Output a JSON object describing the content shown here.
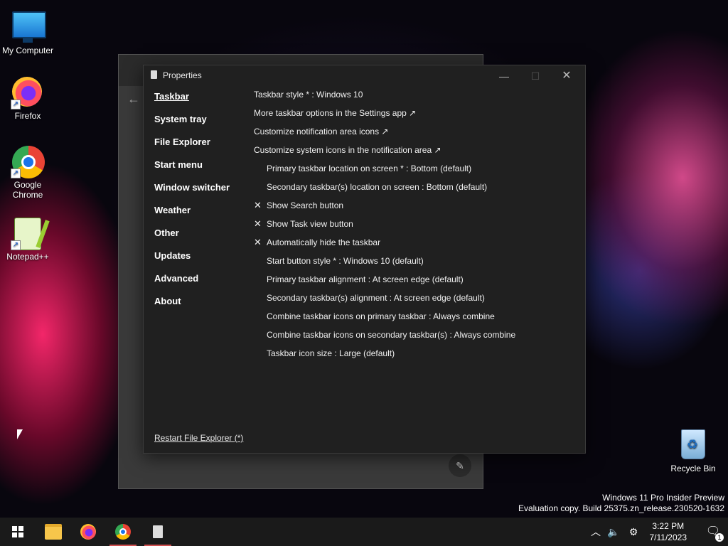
{
  "desktop": {
    "icons": [
      {
        "label": "My Computer"
      },
      {
        "label": "Firefox"
      },
      {
        "label": "Google Chrome"
      },
      {
        "label": "Notepad++"
      },
      {
        "label": "Recycle Bin"
      }
    ]
  },
  "window": {
    "title": "Properties",
    "nav": [
      {
        "label": "Taskbar"
      },
      {
        "label": "System tray"
      },
      {
        "label": "File Explorer"
      },
      {
        "label": "Start menu"
      },
      {
        "label": "Window switcher"
      },
      {
        "label": "Weather"
      },
      {
        "label": "Other"
      },
      {
        "label": "Updates"
      },
      {
        "label": "Advanced"
      },
      {
        "label": "About"
      }
    ],
    "settings": [
      {
        "label": "Taskbar style * : Windows 10"
      },
      {
        "label": "More taskbar options in the Settings app ↗"
      },
      {
        "label": "Customize notification area icons ↗"
      },
      {
        "label": "Customize system icons in the notification area ↗"
      },
      {
        "label": "Primary taskbar location on screen * : Bottom (default)"
      },
      {
        "label": "Secondary taskbar(s) location on screen : Bottom (default)"
      },
      {
        "label": "Show Search button",
        "mark": "✕"
      },
      {
        "label": "Show Task view button",
        "mark": "✕"
      },
      {
        "label": "Automatically hide the taskbar",
        "mark": "✕"
      },
      {
        "label": "Start button style * : Windows 10 (default)"
      },
      {
        "label": "Primary taskbar alignment : At screen edge (default)"
      },
      {
        "label": "Secondary taskbar(s) alignment : At screen edge (default)"
      },
      {
        "label": "Combine taskbar icons on primary taskbar : Always combine"
      },
      {
        "label": "Combine taskbar icons on secondary taskbar(s) : Always combine"
      },
      {
        "label": "Taskbar icon size : Large (default)"
      }
    ],
    "restart_link": "Restart File Explorer (*)"
  },
  "watermark": {
    "line1": "Windows 11 Pro Insider Preview",
    "line2": "Evaluation copy. Build 25375.zn_release.230520-1632"
  },
  "taskbar": {
    "clock_time": "3:22 PM",
    "clock_date": "7/11/2023",
    "notification_count": "1"
  }
}
